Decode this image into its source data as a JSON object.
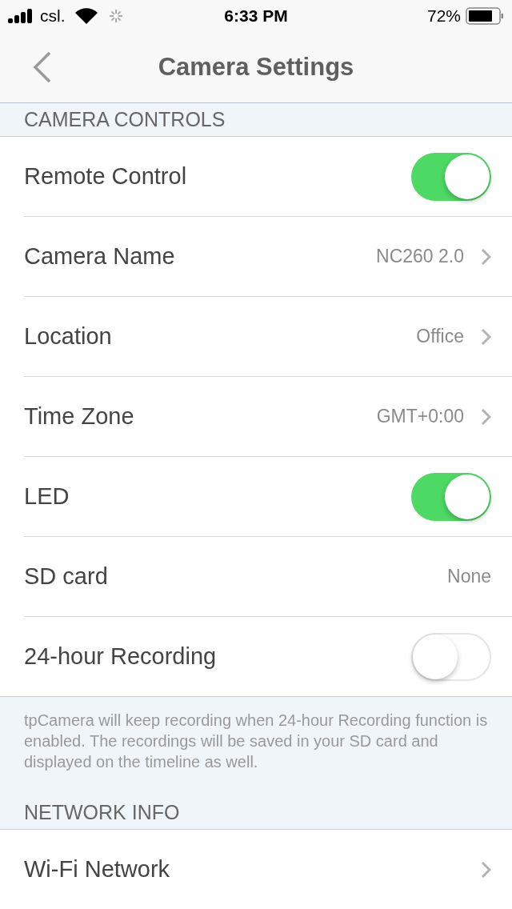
{
  "status_bar": {
    "carrier": "csl.",
    "time": "6:33 PM",
    "battery": "72%"
  },
  "nav": {
    "title": "Camera Settings"
  },
  "sections": [
    {
      "header": "CAMERA CONTROLS",
      "rows": [
        {
          "kind": "toggle",
          "label": "Remote Control",
          "on": true
        },
        {
          "kind": "link",
          "label": "Camera Name",
          "value": "NC260 2.0"
        },
        {
          "kind": "link",
          "label": "Location",
          "value": "Office"
        },
        {
          "kind": "link",
          "label": "Time Zone",
          "value": "GMT+0:00"
        },
        {
          "kind": "toggle",
          "label": "LED",
          "on": true
        },
        {
          "kind": "value",
          "label": "SD card",
          "value": "None"
        },
        {
          "kind": "toggle",
          "label": "24-hour Recording",
          "on": false
        }
      ],
      "footer": "tpCamera will keep recording when 24-hour Recording function is enabled. The recordings will be saved in your SD card and displayed on the timeline as well."
    },
    {
      "header": "NETWORK INFO",
      "rows": [
        {
          "kind": "link",
          "label": "Wi-Fi Network"
        }
      ]
    }
  ]
}
